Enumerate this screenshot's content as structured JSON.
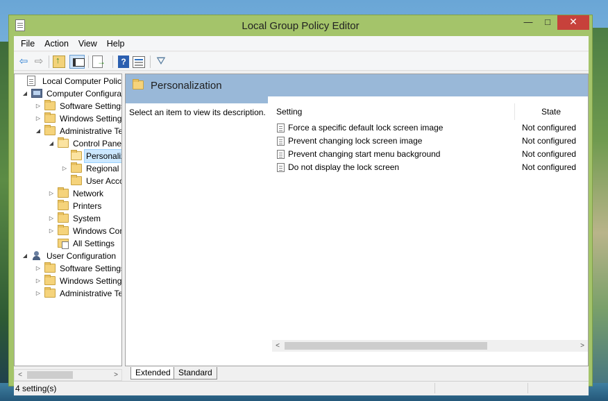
{
  "window": {
    "title": "Local Group Policy Editor",
    "minimize_glyph": "—",
    "maximize_glyph": "□",
    "close_glyph": "✕"
  },
  "menu": [
    "File",
    "Action",
    "View",
    "Help"
  ],
  "toolbar": {
    "back_glyph": "⇦",
    "forward_glyph": "⇨",
    "help_glyph": "?",
    "filter_glyph": "⛛"
  },
  "tree": [
    {
      "label": "Local Computer Policy",
      "icon": "policy-icon",
      "expander": ""
    },
    {
      "label": "Computer Configuration",
      "icon": "computer-icon",
      "expander": "◢"
    },
    {
      "label": "Software Settings",
      "icon": "folder-icon",
      "expander": "▷"
    },
    {
      "label": "Windows Settings",
      "icon": "folder-icon",
      "expander": "▷"
    },
    {
      "label": "Administrative Templates",
      "icon": "folder-icon",
      "expander": "◢"
    },
    {
      "label": "Control Panel",
      "icon": "folder-open-icon",
      "expander": "◢"
    },
    {
      "label": "Personalization",
      "icon": "folder-open-icon",
      "expander": "",
      "selected": true
    },
    {
      "label": "Regional and Language Options",
      "icon": "folder-icon",
      "expander": "▷"
    },
    {
      "label": "User Accounts",
      "icon": "folder-icon",
      "expander": ""
    },
    {
      "label": "Network",
      "icon": "folder-icon",
      "expander": "▷"
    },
    {
      "label": "Printers",
      "icon": "folder-icon",
      "expander": ""
    },
    {
      "label": "System",
      "icon": "folder-icon",
      "expander": "▷"
    },
    {
      "label": "Windows Components",
      "icon": "folder-icon",
      "expander": "▷"
    },
    {
      "label": "All Settings",
      "icon": "all-settings-icon",
      "expander": ""
    },
    {
      "label": "User Configuration",
      "icon": "user-icon",
      "expander": "◢"
    },
    {
      "label": "Software Settings",
      "icon": "folder-icon",
      "expander": "▷"
    },
    {
      "label": "Windows Settings",
      "icon": "folder-icon",
      "expander": "▷"
    },
    {
      "label": "Administrative Templates",
      "icon": "folder-icon",
      "expander": "▷"
    }
  ],
  "right_pane": {
    "header_title": "Personalization",
    "description": "Select an item to view its description.",
    "columns": {
      "setting": "Setting",
      "state": "State"
    },
    "rows": [
      {
        "name": "Force a specific default lock screen image",
        "state": "Not configured"
      },
      {
        "name": "Prevent changing lock screen image",
        "state": "Not configured"
      },
      {
        "name": "Prevent changing start menu background",
        "state": "Not configured"
      },
      {
        "name": "Do not display the lock screen",
        "state": "Not configured"
      }
    ]
  },
  "scroll_glyphs": {
    "left": "<",
    "right": ">"
  },
  "tabs": [
    "Extended",
    "Standard"
  ],
  "status": {
    "text": "4 setting(s)"
  }
}
